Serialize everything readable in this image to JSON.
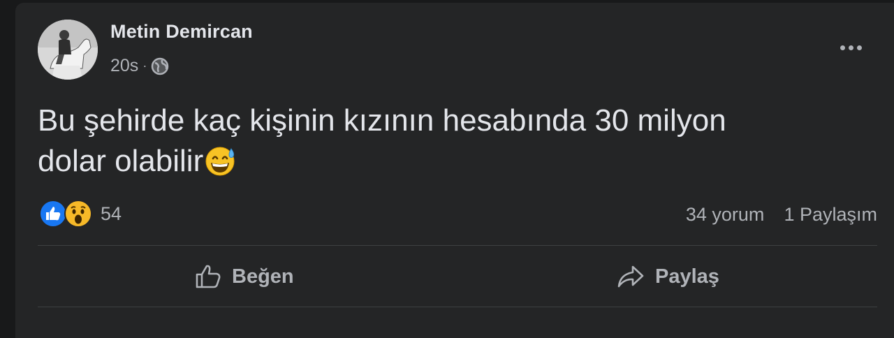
{
  "post": {
    "author": "Metin Demircan",
    "time": "20s",
    "separator": "·",
    "privacy_icon": "globe-icon",
    "more_icon": "more-options-icon",
    "text_line1": "Bu şehirde kaç kişinin kızının hesabında 30 milyon",
    "text_line2": "dolar olabilir",
    "text_emoji": "grinning-sweat-emoji"
  },
  "reactions": {
    "icons": [
      "like-reaction-icon",
      "wow-reaction-icon"
    ],
    "count": "54"
  },
  "stats": {
    "comments": "34 yorum",
    "shares": "1 Paylaşım"
  },
  "actions": {
    "like_label": "Beğen",
    "share_label": "Paylaş"
  },
  "colors": {
    "background": "#18191a",
    "card": "#242526",
    "text_primary": "#e4e6eb",
    "text_secondary": "#b0b3b8",
    "like_blue": "#1877f2",
    "wow_yellow": "#f7b928"
  }
}
